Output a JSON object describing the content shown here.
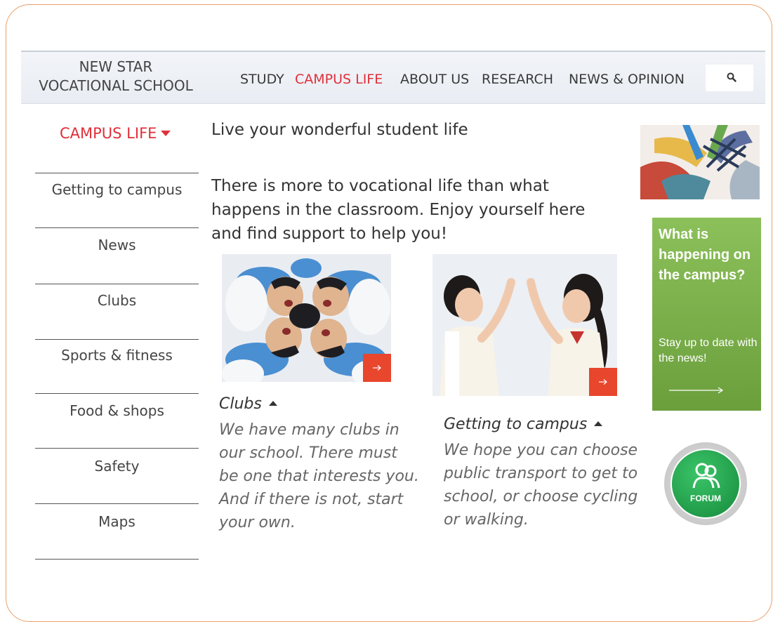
{
  "brand": {
    "line1": "NEW STAR",
    "line2": "VOCATIONAL SCHOOL"
  },
  "nav": {
    "items": [
      {
        "label": "STUDY",
        "active": false
      },
      {
        "label": "CAMPUS LIFE",
        "active": true
      },
      {
        "label": "ABOUT US",
        "active": false
      },
      {
        "label": "RESEARCH",
        "active": false
      },
      {
        "label": "NEWS & OPINION",
        "active": false
      }
    ],
    "search_icon": "search-icon"
  },
  "sidebar": {
    "title": "CAMPUS LIFE",
    "items": [
      {
        "label": "Getting to campus"
      },
      {
        "label": "News"
      },
      {
        "label": "Clubs"
      },
      {
        "label": "Sports & fitness"
      },
      {
        "label": "Food & shops"
      },
      {
        "label": "Safety"
      },
      {
        "label": "Maps"
      }
    ]
  },
  "main": {
    "headline": "Live your wonderful student life",
    "intro": "There is more to vocational life than what happens in the classroom. Enjoy yourself here and find support to help you!",
    "cards": [
      {
        "title": "Clubs",
        "text": "We have many clubs in our school. There must be one that interests you. And if there is not, start your own."
      },
      {
        "title": "Getting to campus",
        "text": "We hope you can choose public transport to get to school, or choose cycling or walking."
      }
    ]
  },
  "promo": {
    "title": "What is happening on the campus?",
    "subtitle": "Stay up to date with the news!"
  },
  "forum": {
    "label": "FORUM"
  },
  "colors": {
    "accent": "#e0303a",
    "arrow_button": "#e8462d",
    "promo_green": "#7cb04a",
    "forum_green": "#22a34a"
  }
}
